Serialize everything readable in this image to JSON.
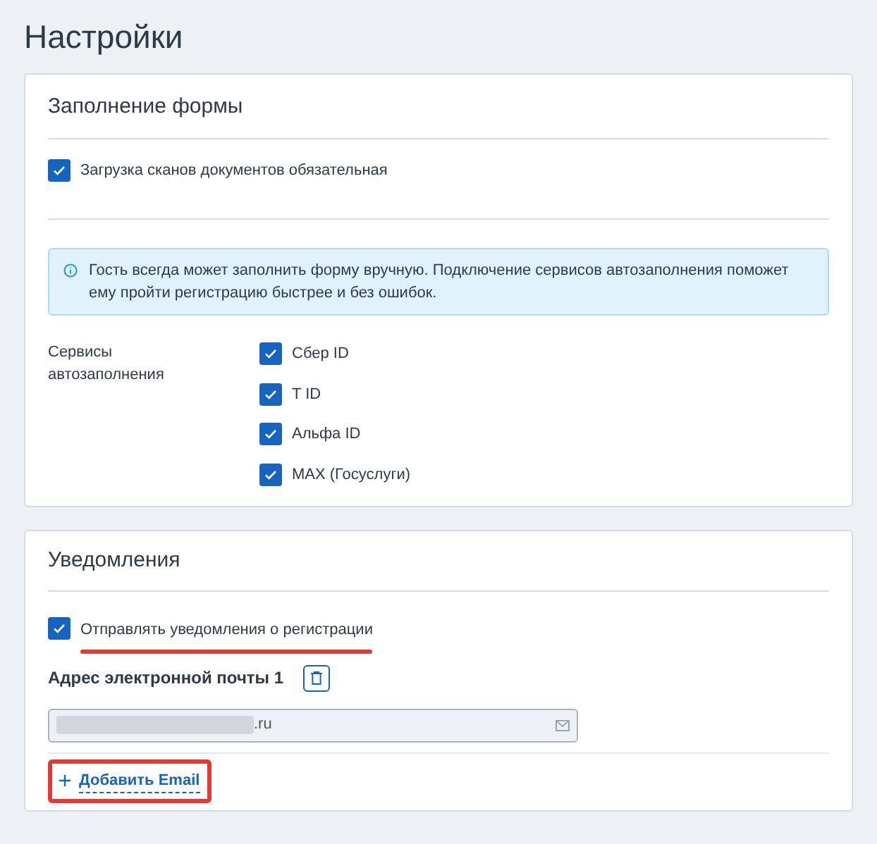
{
  "title": "Настройки",
  "form_section": {
    "heading": "Заполнение формы",
    "scans_required": {
      "label": "Загрузка сканов документов обязательная",
      "checked": true
    },
    "info": "Гость всегда может заполнить форму вручную. Подключение сервисов автозаполнения поможет ему пройти регистрацию быстрее и без ошибок.",
    "services_label": "Сервисы автозаполнения",
    "services": [
      {
        "label": "Сбер ID",
        "checked": true
      },
      {
        "label": "T ID",
        "checked": true
      },
      {
        "label": "Альфа ID",
        "checked": true
      },
      {
        "label": "MAX (Госуслуги)",
        "checked": true
      }
    ]
  },
  "notifications": {
    "heading": "Уведомления",
    "send": {
      "label": "Отправлять уведомления о регистрации",
      "checked": true
    },
    "emails": [
      {
        "label": "Адрес электронной почты 1",
        "value": ".ru"
      }
    ],
    "add_button": "Добавить Email"
  }
}
